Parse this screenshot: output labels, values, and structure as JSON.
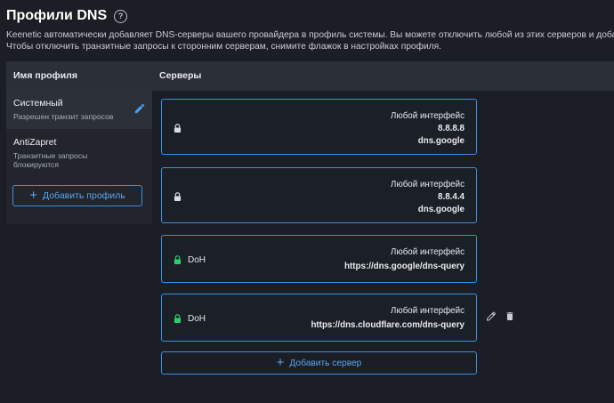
{
  "page": {
    "title": "Профили DNS",
    "help_icon": "?",
    "description_line1": "Keenetic автоматически добавляет DNS-серверы вашего провайдера в профиль системы. Вы можете отключить любой из этих серверов и добавить собственные",
    "description_line2": "Чтобы отключить транзитные запросы к сторонним серверам, снимите флажок в настройках профиля."
  },
  "table": {
    "col_profile": "Имя профиля",
    "col_servers": "Серверы"
  },
  "profiles": [
    {
      "name": "Системный",
      "sub": "Разрешен транзит запросов",
      "active": true
    },
    {
      "name": "AntiZapret",
      "sub": "Транзитные запросы блокируются",
      "active": false
    }
  ],
  "add_profile_label": "Добавить профиль",
  "servers": [
    {
      "interface": "Любой интерфейс",
      "line2": "8.8.8.8",
      "line3": "dns.google",
      "type": "",
      "lock_color": "#d9dce2"
    },
    {
      "interface": "Любой интерфейс",
      "line2": "8.8.4.4",
      "line3": "dns.google",
      "type": "",
      "lock_color": "#d9dce2"
    },
    {
      "interface": "Любой интерфейс",
      "line2": "https://dns.google/dns-query",
      "line3": "",
      "type": "DoH",
      "lock_color": "#2ecc71"
    },
    {
      "interface": "Любой интерфейс",
      "line2": "https://dns.cloudflare.com/dns-query",
      "line3": "",
      "type": "DoH",
      "lock_color": "#2ecc71"
    }
  ],
  "add_server_label": "Добавить сервер",
  "colors": {
    "accent": "#3d8fe0",
    "lock_green": "#2ecc71",
    "background": "#1b1e24"
  },
  "icons": {
    "edit": "pencil-icon",
    "delete": "trash-icon",
    "lock": "lock-icon",
    "plus": "plus-icon"
  }
}
